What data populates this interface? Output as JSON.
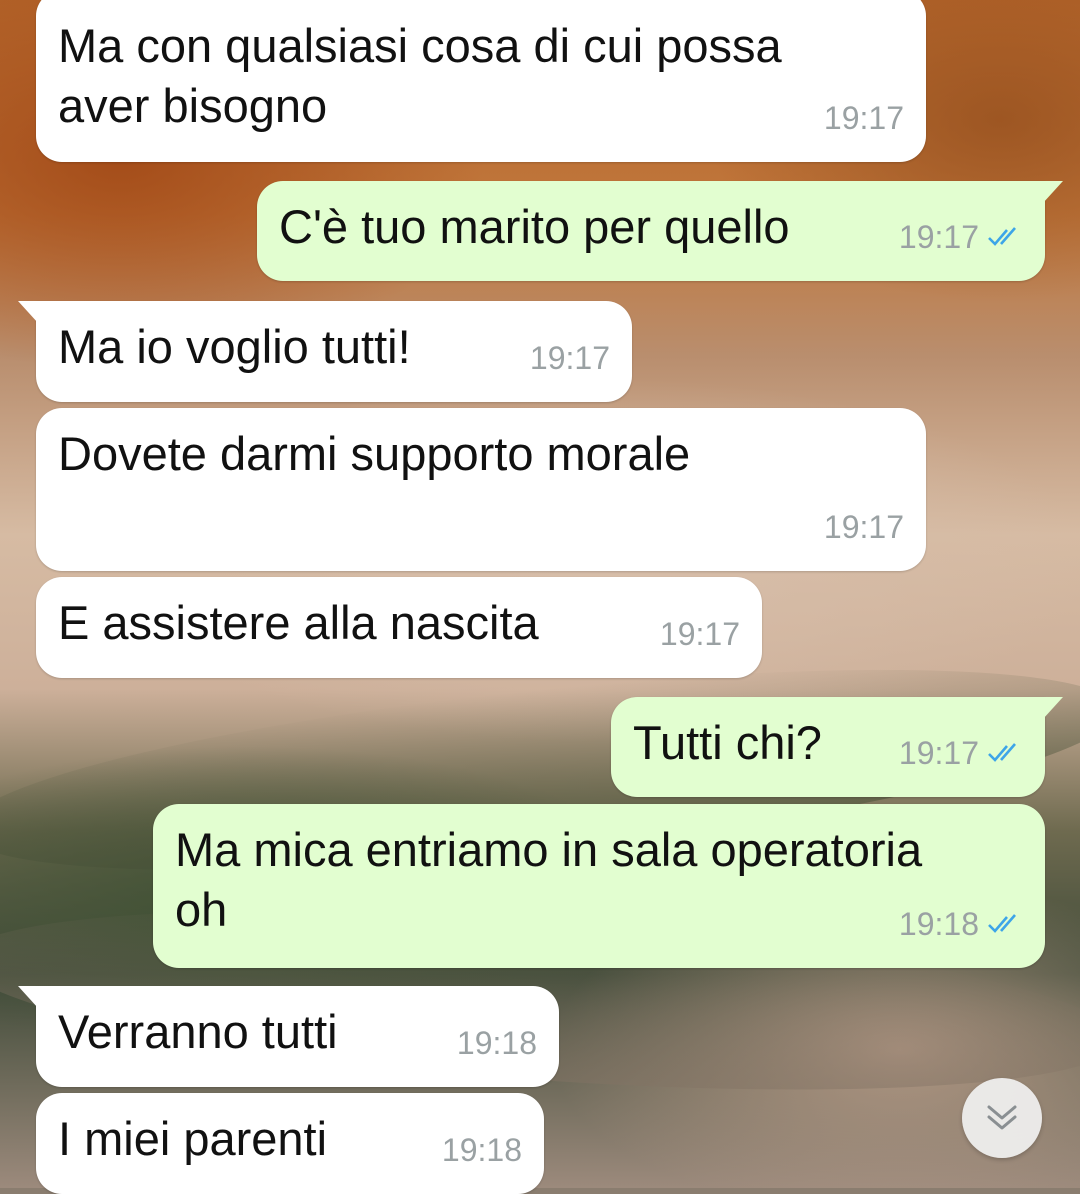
{
  "wallpaper": {
    "description_colors": [
      "#b3642a",
      "#d6bba3",
      "#3f4a38"
    ]
  },
  "colors": {
    "incoming": "#ffffff",
    "outgoing": "#e2fed0",
    "tick_read": "#3da5e8",
    "time": "#9aa1a3"
  },
  "messages": [
    {
      "text": "Ma con qualsiasi cosa di cui possa\naver bisogno",
      "time": "19:17",
      "direction": "in"
    },
    {
      "text": "C'è tuo marito per quello",
      "time": "19:17",
      "direction": "out",
      "status": "read"
    },
    {
      "text": "Ma io voglio tutti!",
      "time": "19:17",
      "direction": "in"
    },
    {
      "text": "Dovete darmi supporto morale",
      "time": "19:17",
      "direction": "in"
    },
    {
      "text": "E assistere alla nascita",
      "time": "19:17",
      "direction": "in"
    },
    {
      "text": "Tutti chi?",
      "time": "19:17",
      "direction": "out",
      "status": "read"
    },
    {
      "text": "Ma mica entriamo in sala operatoria\noh",
      "time": "19:18",
      "direction": "out",
      "status": "read"
    },
    {
      "text": "Verranno tutti",
      "time": "19:18",
      "direction": "in"
    },
    {
      "text": "I miei parenti",
      "time": "19:18",
      "direction": "in"
    }
  ],
  "scroll_button": {
    "icon": "chevron-double-down-icon"
  }
}
